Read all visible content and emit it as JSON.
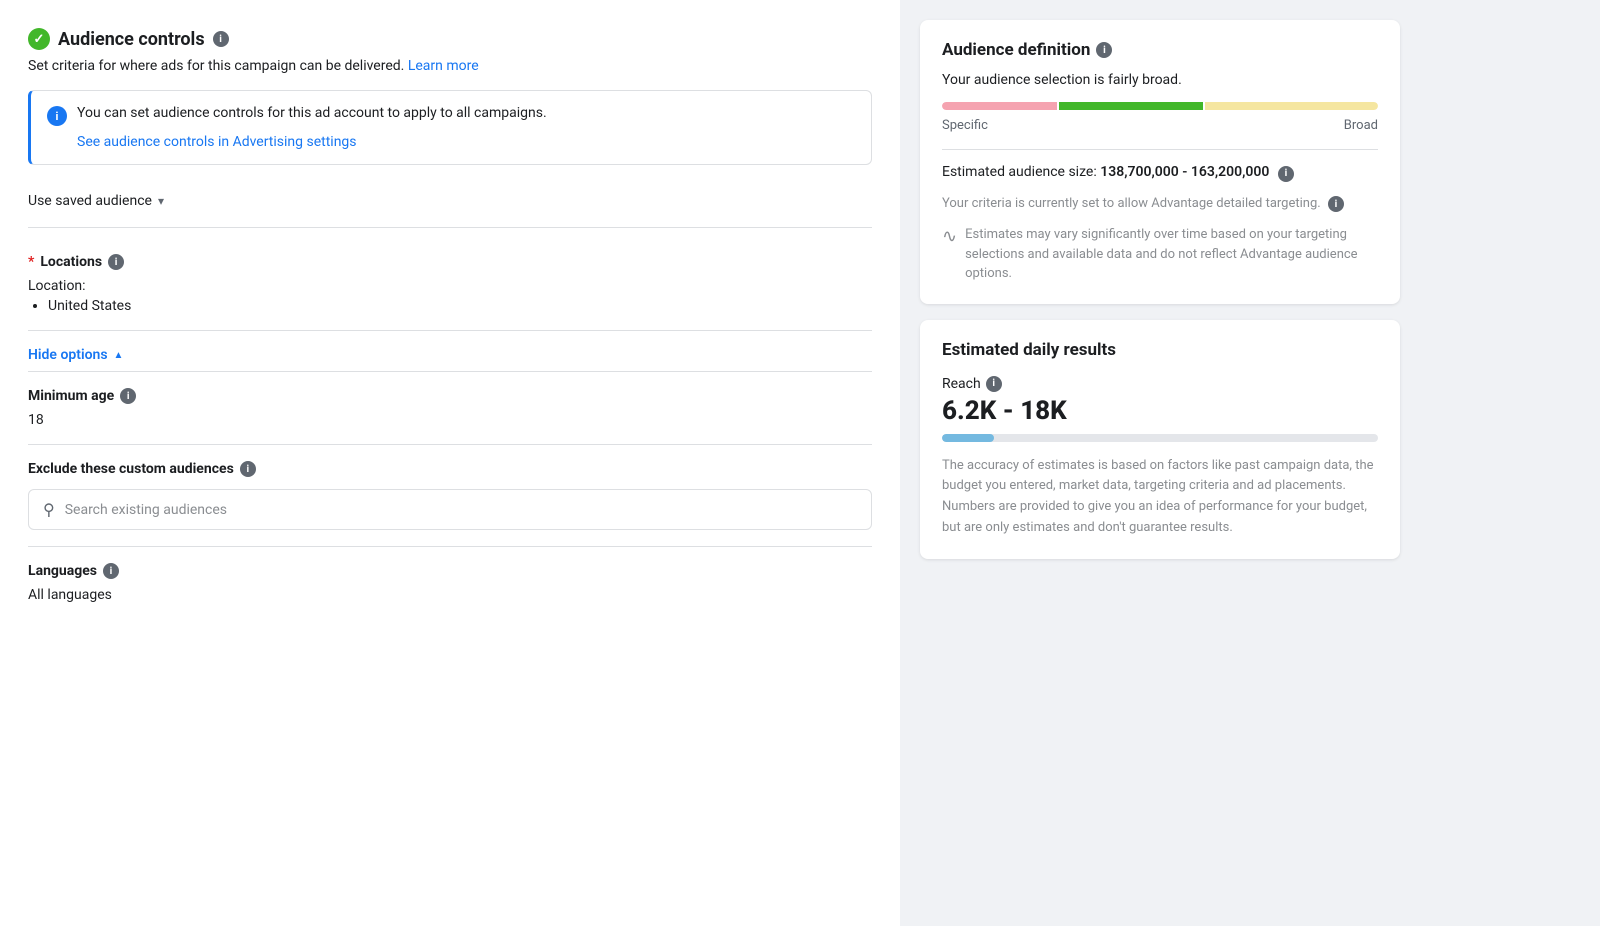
{
  "header": {
    "title": "Audience controls",
    "subtitle": "Set criteria for where ads for this campaign can be delivered.",
    "learn_more": "Learn more"
  },
  "info_banner": {
    "text": "You can set audience controls for this ad account to apply to all campaigns.",
    "link": "See audience controls in Advertising settings"
  },
  "saved_audience": {
    "label": "Use saved audience",
    "arrow": "▾"
  },
  "locations": {
    "label": "Locations",
    "sub_label": "Location:",
    "items": [
      "United States"
    ]
  },
  "hide_options": {
    "label": "Hide options",
    "chevron": "▲"
  },
  "minimum_age": {
    "label": "Minimum age",
    "value": "18"
  },
  "exclude_audiences": {
    "label": "Exclude these custom audiences",
    "search_placeholder": "Search existing audiences"
  },
  "languages": {
    "label": "Languages",
    "value": "All languages"
  },
  "audience_definition": {
    "title": "Audience definition",
    "description": "Your audience selection is fairly broad.",
    "meter_labels": {
      "left": "Specific",
      "right": "Broad"
    },
    "estimated_size_label": "Estimated audience size:",
    "estimated_size_value": "138,700,000 - 163,200,000",
    "criteria_text": "Your criteria is currently set to allow Advantage detailed targeting.",
    "estimates_text": "Estimates may vary significantly over time based on your targeting selections and available data and do not reflect Advantage audience options."
  },
  "daily_results": {
    "title": "Estimated daily results",
    "reach_label": "Reach",
    "reach_value": "6.2K - 18K",
    "accuracy_text": "The accuracy of estimates is based on factors like past campaign data, the budget you entered, market data, targeting criteria and ad placements. Numbers are provided to give you an idea of performance for your budget, but are only estimates and don't guarantee results."
  }
}
